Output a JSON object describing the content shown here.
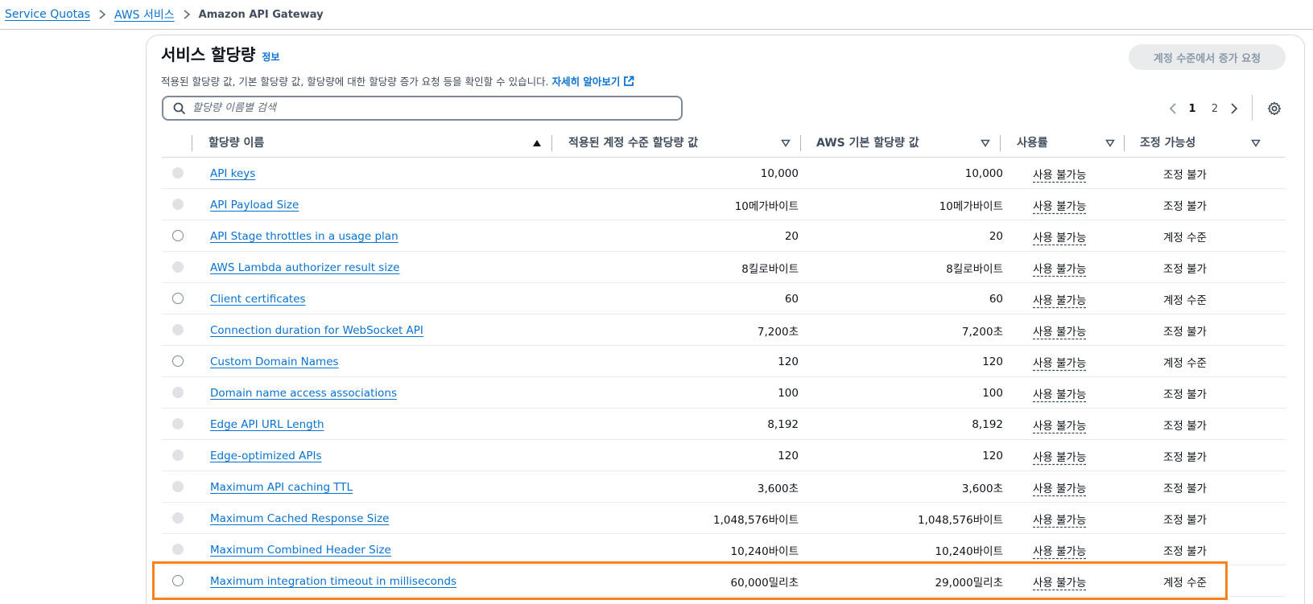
{
  "breadcrumb": {
    "items": [
      "Service Quotas",
      "AWS 서비스"
    ],
    "current": "Amazon API Gateway"
  },
  "header": {
    "title": "서비스 할당량",
    "info": "정보",
    "description": "적용된 할당량 값, 기본 할당량 값, 할당량에 대한 할당량 증가 요청 등을 확인할 수 있습니다.",
    "learn_more": "자세히 알아보기",
    "request_button": "계정 수준에서 증가 요청"
  },
  "search": {
    "placeholder": "할당량 이름별 검색",
    "value": ""
  },
  "pagination": {
    "pages": [
      "1",
      "2"
    ],
    "current": "1"
  },
  "table": {
    "columns": [
      "할당량 이름",
      "적용된 계정 수준 할당량 값",
      "AWS 기본 할당량 값",
      "사용률",
      "조정 가능성"
    ],
    "rows": [
      {
        "name": "API keys",
        "applied": "10,000",
        "default": "10,000",
        "utilization": "사용 불가능",
        "adjustability": "조정 불가",
        "selectable": false
      },
      {
        "name": "API Payload Size",
        "applied": "10메가바이트",
        "default": "10메가바이트",
        "utilization": "사용 불가능",
        "adjustability": "조정 불가",
        "selectable": false
      },
      {
        "name": "API Stage throttles in a usage plan",
        "applied": "20",
        "default": "20",
        "utilization": "사용 불가능",
        "adjustability": "계정 수준",
        "selectable": true
      },
      {
        "name": "AWS Lambda authorizer result size",
        "applied": "8킬로바이트",
        "default": "8킬로바이트",
        "utilization": "사용 불가능",
        "adjustability": "조정 불가",
        "selectable": false
      },
      {
        "name": "Client certificates",
        "applied": "60",
        "default": "60",
        "utilization": "사용 불가능",
        "adjustability": "계정 수준",
        "selectable": true
      },
      {
        "name": "Connection duration for WebSocket API",
        "applied": "7,200초",
        "default": "7,200초",
        "utilization": "사용 불가능",
        "adjustability": "조정 불가",
        "selectable": false
      },
      {
        "name": "Custom Domain Names",
        "applied": "120",
        "default": "120",
        "utilization": "사용 불가능",
        "adjustability": "계정 수준",
        "selectable": true
      },
      {
        "name": "Domain name access associations",
        "applied": "100",
        "default": "100",
        "utilization": "사용 불가능",
        "adjustability": "조정 불가",
        "selectable": false
      },
      {
        "name": "Edge API URL Length",
        "applied": "8,192",
        "default": "8,192",
        "utilization": "사용 불가능",
        "adjustability": "조정 불가",
        "selectable": false
      },
      {
        "name": "Edge-optimized APIs",
        "applied": "120",
        "default": "120",
        "utilization": "사용 불가능",
        "adjustability": "조정 불가",
        "selectable": false
      },
      {
        "name": "Maximum API caching TTL",
        "applied": "3,600초",
        "default": "3,600초",
        "utilization": "사용 불가능",
        "adjustability": "조정 불가",
        "selectable": false
      },
      {
        "name": "Maximum Cached Response Size",
        "applied": "1,048,576바이트",
        "default": "1,048,576바이트",
        "utilization": "사용 불가능",
        "adjustability": "조정 불가",
        "selectable": false
      },
      {
        "name": "Maximum Combined Header Size",
        "applied": "10,240바이트",
        "default": "10,240바이트",
        "utilization": "사용 불가능",
        "adjustability": "조정 불가",
        "selectable": false
      },
      {
        "name": "Maximum integration timeout in milliseconds",
        "applied": "60,000밀리초",
        "default": "29,000밀리초",
        "utilization": "사용 불가능",
        "adjustability": "계정 수준",
        "selectable": true
      }
    ]
  },
  "colors": {
    "link": "#0972d3",
    "highlight": "#f5821f",
    "text": "#0f141a"
  }
}
